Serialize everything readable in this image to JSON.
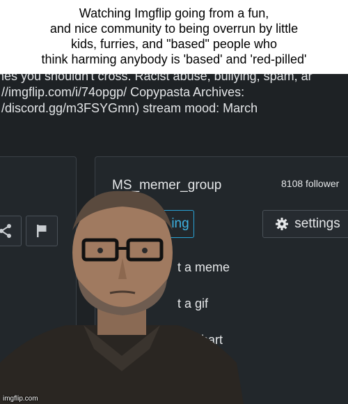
{
  "meme": {
    "caption_lines": [
      "Watching Imgflip going from a fun,",
      "and nice community to being overrun by little",
      "kids, furries, and \"based\" people who",
      "think harming anybody is 'based' and 'red-pilled'"
    ],
    "watermark": "imgflip.com"
  },
  "stream": {
    "description_lines": [
      "nes you shouldn't cross. Racist abuse, bullying, spam, ar",
      "//imgflip.com/i/74opgp/ Copypasta Archives:",
      "/discord.gg/m3FSYGmn) stream mood: March"
    ],
    "name": "MS_memer_group",
    "followers": "8108 follower",
    "following_label": "ing",
    "settings_label": "settings",
    "actions": [
      "t a meme",
      "t a gif",
      "t a chart"
    ]
  },
  "colors": {
    "background": "#1e2225",
    "panel": "#22272b",
    "accent": "#29a3d6",
    "text": "#e6e8ea"
  },
  "icons": [
    "share-icon",
    "flag-icon",
    "gear-icon"
  ]
}
